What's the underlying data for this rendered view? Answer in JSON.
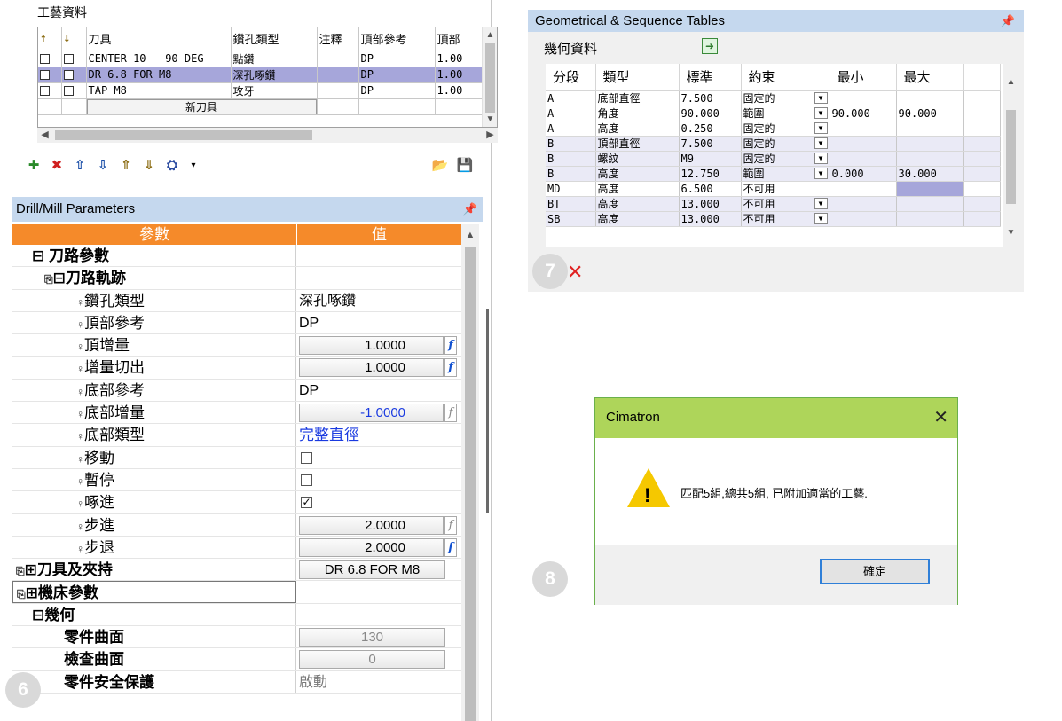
{
  "process": {
    "title": "工藝資料",
    "columns": [
      "刀具",
      "鑽孔類型",
      "注釋",
      "頂部參考",
      "頂部"
    ],
    "rows": [
      {
        "tool": "CENTER 10 - 90 DEG",
        "type": "點鑽",
        "note": "",
        "top_ref": "DP",
        "top": "1.00"
      },
      {
        "tool": "DR 6.8 FOR M8",
        "type": "深孔啄鑽",
        "note": "",
        "top_ref": "DP",
        "top": "1.00",
        "selected": true
      },
      {
        "tool": "TAP M8",
        "type": "攻牙",
        "note": "",
        "top_ref": "DP",
        "top": "1.00"
      }
    ],
    "new_tool_label": "新刀具",
    "toolbar_icons": [
      "add-tool-icon",
      "delete-tool-icon",
      "move-up-icon",
      "move-down-icon",
      "sort-up-icon",
      "sort-down-icon",
      "tool-holder-icon",
      "dropdown-arrow-icon",
      "load-icon",
      "save-icon"
    ]
  },
  "drill": {
    "header": "Drill/Mill Parameters",
    "col_param": "參數",
    "col_value": "值",
    "rows": {
      "path_params": "刀路參數",
      "trajectory": "刀路軌跡",
      "drill_type": {
        "label": "鑽孔類型",
        "value": "深孔啄鑽"
      },
      "top_ref": {
        "label": "頂部參考",
        "value": "DP"
      },
      "top_inc": {
        "label": "頂增量",
        "value": "1.0000"
      },
      "inc_cutout": {
        "label": "增量切出",
        "value": "1.0000"
      },
      "bottom_ref": {
        "label": "底部參考",
        "value": "DP"
      },
      "bottom_inc": {
        "label": "底部增量",
        "value": "-1.0000"
      },
      "bottom_type": {
        "label": "底部類型",
        "value": "完整直徑"
      },
      "move": {
        "label": "移動"
      },
      "pause": {
        "label": "暫停"
      },
      "peck": {
        "label": "啄進"
      },
      "step_in": {
        "label": "步進",
        "value": "2.0000"
      },
      "step_back": {
        "label": "步退",
        "value": "2.0000"
      },
      "tool_holder": {
        "label": "刀具及夾持",
        "value": "DR 6.8 FOR M8"
      },
      "machine": {
        "label": "機床參數"
      },
      "geometry": {
        "label": "幾何"
      },
      "part_surface": {
        "label": "零件曲面",
        "value": "130"
      },
      "check_surface": {
        "label": "檢查曲面",
        "value": "0"
      },
      "part_safety": {
        "label": "零件安全保護",
        "value": "啟動"
      }
    },
    "func_symbol": "f"
  },
  "geo": {
    "header": "Geometrical & Sequence Tables",
    "sub": "幾何資料",
    "columns": [
      "分段",
      "類型",
      "標準",
      "約束",
      "最小",
      "最大"
    ],
    "rows": [
      {
        "seg": "A",
        "type": "底部直徑",
        "std": "7.500",
        "con": "固定的",
        "min": "",
        "max": ""
      },
      {
        "seg": "A",
        "type": "角度",
        "std": "90.000",
        "con": "範圍",
        "min": "90.000",
        "max": "90.000"
      },
      {
        "seg": "A",
        "type": "高度",
        "std": "0.250",
        "con": "固定的",
        "min": "",
        "max": ""
      },
      {
        "seg": "B",
        "type": "頂部直徑",
        "std": "7.500",
        "con": "固定的",
        "min": "",
        "max": ""
      },
      {
        "seg": "B",
        "type": "螺紋",
        "std": "M9",
        "con": "固定的",
        "min": "",
        "max": ""
      },
      {
        "seg": "B",
        "type": "高度",
        "std": "12.750",
        "con": "範圍",
        "min": "0.000",
        "max": "30.000"
      },
      {
        "seg": "MD",
        "type": "高度",
        "std": "6.500",
        "con": "不可用",
        "min": "",
        "max": ""
      },
      {
        "seg": "BT",
        "type": "高度",
        "std": "13.000",
        "con": "不可用",
        "min": "",
        "max": ""
      },
      {
        "seg": "SB",
        "type": "高度",
        "std": "13.000",
        "con": "不可用",
        "min": "",
        "max": ""
      }
    ]
  },
  "dialog": {
    "title": "Cimatron",
    "message": "匹配5組,總共5組, 已附加適當的工藝.",
    "ok": "確定"
  },
  "badges": {
    "b6": "6",
    "b7": "7",
    "b8": "8"
  },
  "colors": {
    "accent_orange": "#f58a2a",
    "panel_header": "#c5d8ee",
    "selection": "#a6a6da",
    "dialog_title": "#aed55a"
  }
}
